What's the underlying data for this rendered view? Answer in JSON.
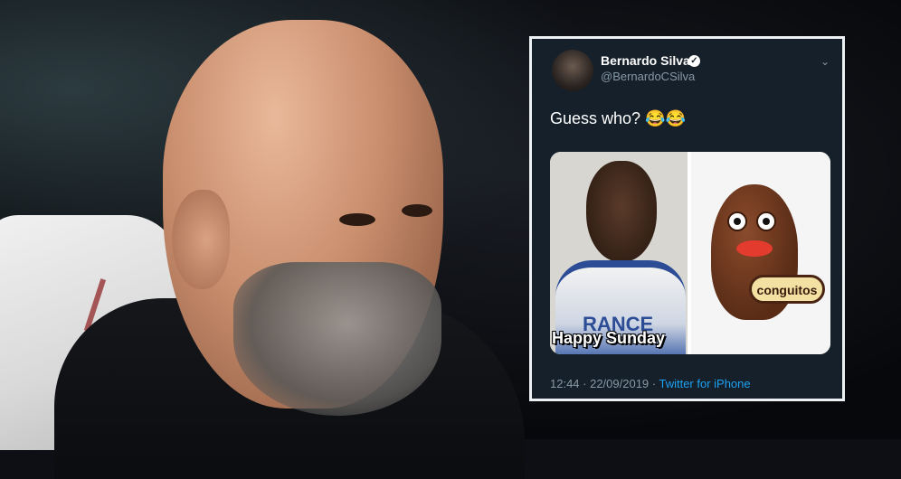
{
  "tweet": {
    "display_name": "Bernardo Silva",
    "handle": "@BernardoCSilva",
    "verified_mark": "✓",
    "body": "Guess who? 😂😂",
    "timestamp": "12:44 · 22/09/2019 · ",
    "source": "Twitter for iPhone",
    "chevron": "⌄",
    "media": {
      "left_caption": "Happy Sunday",
      "shirt_text": "RANCE",
      "mascot_label": "conguitos"
    }
  },
  "colors": {
    "tweet_background": "#15202b",
    "link_blue": "#1da1f2",
    "muted_text": "#8899a6"
  }
}
